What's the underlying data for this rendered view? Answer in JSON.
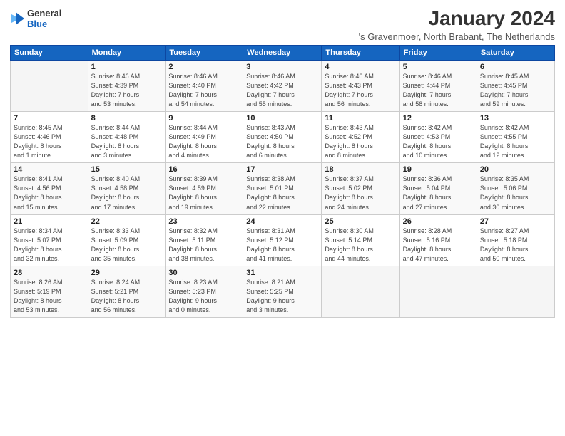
{
  "logo": {
    "line1": "General",
    "line2": "Blue"
  },
  "title": "January 2024",
  "location": "'s Gravenmoer, North Brabant, The Netherlands",
  "days_of_week": [
    "Sunday",
    "Monday",
    "Tuesday",
    "Wednesday",
    "Thursday",
    "Friday",
    "Saturday"
  ],
  "weeks": [
    [
      {
        "day": "",
        "info": ""
      },
      {
        "day": "1",
        "info": "Sunrise: 8:46 AM\nSunset: 4:39 PM\nDaylight: 7 hours\nand 53 minutes."
      },
      {
        "day": "2",
        "info": "Sunrise: 8:46 AM\nSunset: 4:40 PM\nDaylight: 7 hours\nand 54 minutes."
      },
      {
        "day": "3",
        "info": "Sunrise: 8:46 AM\nSunset: 4:42 PM\nDaylight: 7 hours\nand 55 minutes."
      },
      {
        "day": "4",
        "info": "Sunrise: 8:46 AM\nSunset: 4:43 PM\nDaylight: 7 hours\nand 56 minutes."
      },
      {
        "day": "5",
        "info": "Sunrise: 8:46 AM\nSunset: 4:44 PM\nDaylight: 7 hours\nand 58 minutes."
      },
      {
        "day": "6",
        "info": "Sunrise: 8:45 AM\nSunset: 4:45 PM\nDaylight: 7 hours\nand 59 minutes."
      }
    ],
    [
      {
        "day": "7",
        "info": "Sunrise: 8:45 AM\nSunset: 4:46 PM\nDaylight: 8 hours\nand 1 minute."
      },
      {
        "day": "8",
        "info": "Sunrise: 8:44 AM\nSunset: 4:48 PM\nDaylight: 8 hours\nand 3 minutes."
      },
      {
        "day": "9",
        "info": "Sunrise: 8:44 AM\nSunset: 4:49 PM\nDaylight: 8 hours\nand 4 minutes."
      },
      {
        "day": "10",
        "info": "Sunrise: 8:43 AM\nSunset: 4:50 PM\nDaylight: 8 hours\nand 6 minutes."
      },
      {
        "day": "11",
        "info": "Sunrise: 8:43 AM\nSunset: 4:52 PM\nDaylight: 8 hours\nand 8 minutes."
      },
      {
        "day": "12",
        "info": "Sunrise: 8:42 AM\nSunset: 4:53 PM\nDaylight: 8 hours\nand 10 minutes."
      },
      {
        "day": "13",
        "info": "Sunrise: 8:42 AM\nSunset: 4:55 PM\nDaylight: 8 hours\nand 12 minutes."
      }
    ],
    [
      {
        "day": "14",
        "info": "Sunrise: 8:41 AM\nSunset: 4:56 PM\nDaylight: 8 hours\nand 15 minutes."
      },
      {
        "day": "15",
        "info": "Sunrise: 8:40 AM\nSunset: 4:58 PM\nDaylight: 8 hours\nand 17 minutes."
      },
      {
        "day": "16",
        "info": "Sunrise: 8:39 AM\nSunset: 4:59 PM\nDaylight: 8 hours\nand 19 minutes."
      },
      {
        "day": "17",
        "info": "Sunrise: 8:38 AM\nSunset: 5:01 PM\nDaylight: 8 hours\nand 22 minutes."
      },
      {
        "day": "18",
        "info": "Sunrise: 8:37 AM\nSunset: 5:02 PM\nDaylight: 8 hours\nand 24 minutes."
      },
      {
        "day": "19",
        "info": "Sunrise: 8:36 AM\nSunset: 5:04 PM\nDaylight: 8 hours\nand 27 minutes."
      },
      {
        "day": "20",
        "info": "Sunrise: 8:35 AM\nSunset: 5:06 PM\nDaylight: 8 hours\nand 30 minutes."
      }
    ],
    [
      {
        "day": "21",
        "info": "Sunrise: 8:34 AM\nSunset: 5:07 PM\nDaylight: 8 hours\nand 32 minutes."
      },
      {
        "day": "22",
        "info": "Sunrise: 8:33 AM\nSunset: 5:09 PM\nDaylight: 8 hours\nand 35 minutes."
      },
      {
        "day": "23",
        "info": "Sunrise: 8:32 AM\nSunset: 5:11 PM\nDaylight: 8 hours\nand 38 minutes."
      },
      {
        "day": "24",
        "info": "Sunrise: 8:31 AM\nSunset: 5:12 PM\nDaylight: 8 hours\nand 41 minutes."
      },
      {
        "day": "25",
        "info": "Sunrise: 8:30 AM\nSunset: 5:14 PM\nDaylight: 8 hours\nand 44 minutes."
      },
      {
        "day": "26",
        "info": "Sunrise: 8:28 AM\nSunset: 5:16 PM\nDaylight: 8 hours\nand 47 minutes."
      },
      {
        "day": "27",
        "info": "Sunrise: 8:27 AM\nSunset: 5:18 PM\nDaylight: 8 hours\nand 50 minutes."
      }
    ],
    [
      {
        "day": "28",
        "info": "Sunrise: 8:26 AM\nSunset: 5:19 PM\nDaylight: 8 hours\nand 53 minutes."
      },
      {
        "day": "29",
        "info": "Sunrise: 8:24 AM\nSunset: 5:21 PM\nDaylight: 8 hours\nand 56 minutes."
      },
      {
        "day": "30",
        "info": "Sunrise: 8:23 AM\nSunset: 5:23 PM\nDaylight: 9 hours\nand 0 minutes."
      },
      {
        "day": "31",
        "info": "Sunrise: 8:21 AM\nSunset: 5:25 PM\nDaylight: 9 hours\nand 3 minutes."
      },
      {
        "day": "",
        "info": ""
      },
      {
        "day": "",
        "info": ""
      },
      {
        "day": "",
        "info": ""
      }
    ]
  ]
}
